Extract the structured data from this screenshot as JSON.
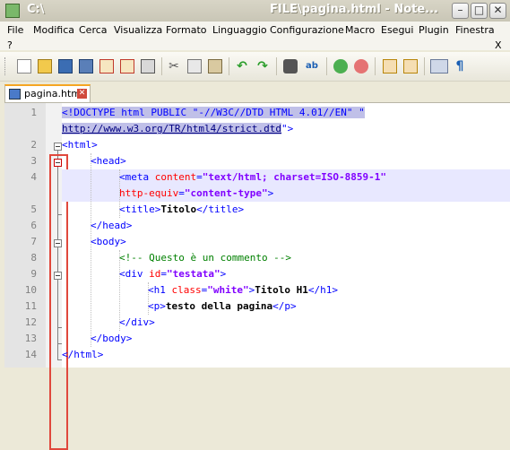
{
  "window": {
    "title_left": "C:\\",
    "title_right": "FILE\\pagina.html - Note...",
    "minimize": "–",
    "maximize": "□",
    "close": "✕"
  },
  "menu": {
    "items": [
      "File",
      "Modifica",
      "Cerca",
      "Visualizza",
      "Formato",
      "Linguaggio",
      "Configurazione",
      "Macro",
      "Esegui",
      "Plugin",
      "Finestra"
    ],
    "help": "?",
    "close_doc": "X"
  },
  "toolbar": {
    "icons": [
      "new-icon",
      "open-icon",
      "save-icon",
      "save-all-icon",
      "close-icon",
      "close-all-icon",
      "print-icon",
      "cut-icon",
      "copy-icon",
      "paste-icon",
      "undo-icon",
      "redo-icon",
      "find-icon",
      "replace-icon",
      "zoom-in-icon",
      "zoom-out-icon",
      "sync-v-icon",
      "sync-h-icon",
      "wrap-icon",
      "show-symbols-icon"
    ]
  },
  "tab": {
    "label": "pagina.html",
    "close": "✕"
  },
  "editor": {
    "line_numbers": [
      "1",
      "",
      "2",
      "3",
      "4",
      "",
      "5",
      "6",
      "7",
      "8",
      "9",
      "10",
      "11",
      "12",
      "13",
      "14"
    ],
    "line1a": "<!DOCTYPE html PUBLIC \"-//W3C//DTD HTML 4.01//EN\" \"",
    "line1b": "http://www.w3.org/TR/html4/strict.dtd",
    "line1c": "\">",
    "html_open": "<html>",
    "head_open": "<head>",
    "meta_tag": "<meta",
    "meta_content_attr": "content",
    "meta_content_val": "\"text/html; charset=ISO-8859-1\"",
    "meta_equiv_attr": "http-equiv",
    "meta_equiv_val": "\"content-type\"",
    "meta_end": ">",
    "title_open": "<title>",
    "title_text": "Titolo",
    "title_close": "</title>",
    "head_close": "</head>",
    "body_open": "<body>",
    "comment": "<!-- Questo è un commento -->",
    "div_open": "<div",
    "div_attr": "id",
    "div_val": "\"testata\"",
    "div_end": ">",
    "h1_open": "<h1",
    "h1_attr": "class",
    "h1_val": "\"white\"",
    "h1_end": ">",
    "h1_text": "Titolo H1",
    "h1_close": "</h1>",
    "p_open": "<p>",
    "p_text": "testo della pagina",
    "p_close": "</p>",
    "div_close": "</div>",
    "body_close": "</body>",
    "html_close": "</html>"
  },
  "colors": {
    "tag": "#0000ff",
    "attribute": "#ff0000",
    "value": "#8000ff",
    "comment": "#008000",
    "highlight_box": "#e0483c"
  }
}
